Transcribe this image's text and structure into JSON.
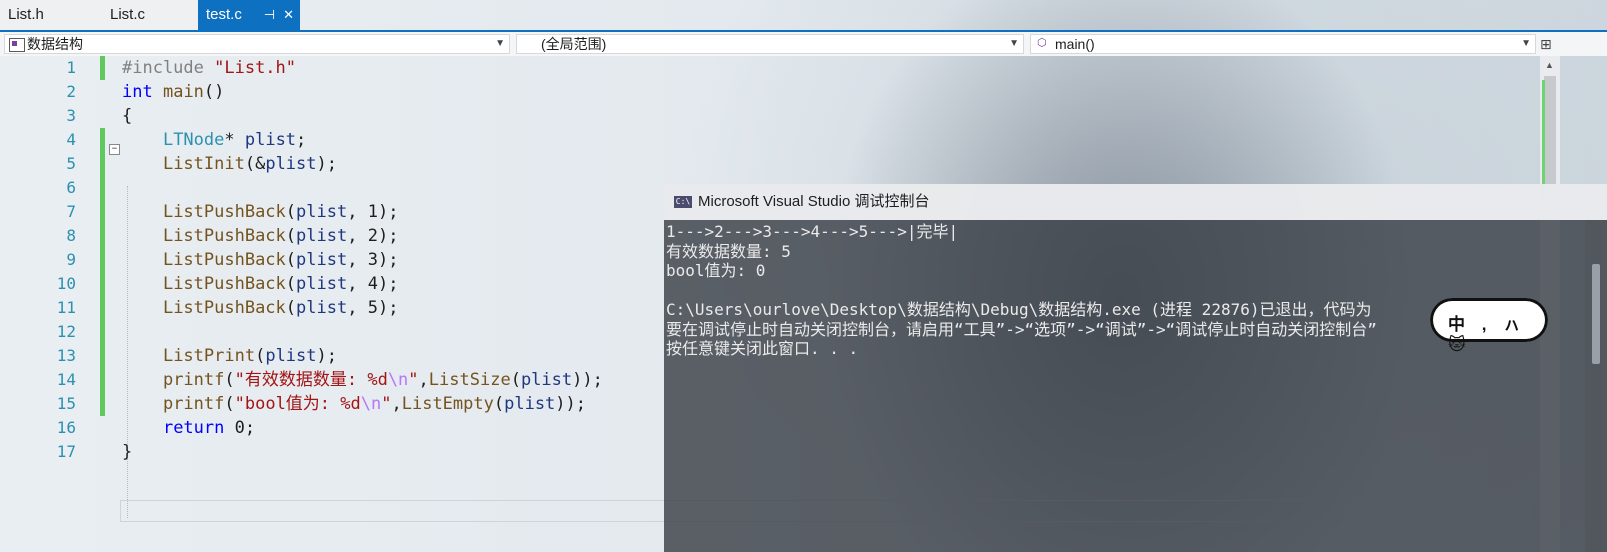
{
  "tabs": [
    {
      "label": "List.h"
    },
    {
      "label": "List.c"
    },
    {
      "label": "test.c",
      "active": true,
      "pin_icon": "pin-icon",
      "close_icon": "close-icon"
    }
  ],
  "navbar": {
    "project": "数据结构",
    "scope": "(全局范围)",
    "member": "main()",
    "icons": [
      "project-icon",
      "member-cube-icon",
      "split-editor-icon"
    ]
  },
  "editor": {
    "line_numbers": [
      "1",
      "2",
      "3",
      "4",
      "5",
      "6",
      "7",
      "8",
      "9",
      "10",
      "11",
      "12",
      "13",
      "14",
      "15",
      "16",
      "17"
    ],
    "lines": [
      [
        {
          "t": "#include ",
          "c": "pp"
        },
        {
          "t": "\"List.h\"",
          "c": "str"
        }
      ],
      [
        {
          "t": "int",
          "c": "kw"
        },
        {
          "t": " ",
          "c": "pl"
        },
        {
          "t": "main",
          "c": "fn"
        },
        {
          "t": "()",
          "c": "pl"
        }
      ],
      [
        {
          "t": "{",
          "c": "pl"
        }
      ],
      [
        {
          "t": "    ",
          "c": "pl"
        },
        {
          "t": "LTNode",
          "c": "ty"
        },
        {
          "t": "* ",
          "c": "pl"
        },
        {
          "t": "plist",
          "c": "var"
        },
        {
          "t": ";",
          "c": "pl"
        }
      ],
      [
        {
          "t": "    ",
          "c": "pl"
        },
        {
          "t": "ListInit",
          "c": "fn"
        },
        {
          "t": "(&",
          "c": "pl"
        },
        {
          "t": "plist",
          "c": "var"
        },
        {
          "t": ");",
          "c": "pl"
        }
      ],
      [
        {
          "t": "",
          "c": "pl"
        }
      ],
      [
        {
          "t": "    ",
          "c": "pl"
        },
        {
          "t": "ListPushBack",
          "c": "fn"
        },
        {
          "t": "(",
          "c": "pl"
        },
        {
          "t": "plist",
          "c": "var"
        },
        {
          "t": ", ",
          "c": "pl"
        },
        {
          "t": "1",
          "c": "pl"
        },
        {
          "t": ");",
          "c": "pl"
        }
      ],
      [
        {
          "t": "    ",
          "c": "pl"
        },
        {
          "t": "ListPushBack",
          "c": "fn"
        },
        {
          "t": "(",
          "c": "pl"
        },
        {
          "t": "plist",
          "c": "var"
        },
        {
          "t": ", ",
          "c": "pl"
        },
        {
          "t": "2",
          "c": "pl"
        },
        {
          "t": ");",
          "c": "pl"
        }
      ],
      [
        {
          "t": "    ",
          "c": "pl"
        },
        {
          "t": "ListPushBack",
          "c": "fn"
        },
        {
          "t": "(",
          "c": "pl"
        },
        {
          "t": "plist",
          "c": "var"
        },
        {
          "t": ", ",
          "c": "pl"
        },
        {
          "t": "3",
          "c": "pl"
        },
        {
          "t": ");",
          "c": "pl"
        }
      ],
      [
        {
          "t": "    ",
          "c": "pl"
        },
        {
          "t": "ListPushBack",
          "c": "fn"
        },
        {
          "t": "(",
          "c": "pl"
        },
        {
          "t": "plist",
          "c": "var"
        },
        {
          "t": ", ",
          "c": "pl"
        },
        {
          "t": "4",
          "c": "pl"
        },
        {
          "t": ");",
          "c": "pl"
        }
      ],
      [
        {
          "t": "    ",
          "c": "pl"
        },
        {
          "t": "ListPushBack",
          "c": "fn"
        },
        {
          "t": "(",
          "c": "pl"
        },
        {
          "t": "plist",
          "c": "var"
        },
        {
          "t": ", ",
          "c": "pl"
        },
        {
          "t": "5",
          "c": "pl"
        },
        {
          "t": ");",
          "c": "pl"
        }
      ],
      [
        {
          "t": "",
          "c": "pl"
        }
      ],
      [
        {
          "t": "    ",
          "c": "pl"
        },
        {
          "t": "ListPrint",
          "c": "fn"
        },
        {
          "t": "(",
          "c": "pl"
        },
        {
          "t": "plist",
          "c": "var"
        },
        {
          "t": ");",
          "c": "pl"
        }
      ],
      [
        {
          "t": "    ",
          "c": "pl"
        },
        {
          "t": "printf",
          "c": "fn"
        },
        {
          "t": "(",
          "c": "pl"
        },
        {
          "t": "\"有效数据数量: %d",
          "c": "str"
        },
        {
          "t": "\\n",
          "c": "esc"
        },
        {
          "t": "\"",
          "c": "str"
        },
        {
          "t": ",",
          "c": "pl"
        },
        {
          "t": "ListSize",
          "c": "fn"
        },
        {
          "t": "(",
          "c": "pl"
        },
        {
          "t": "plist",
          "c": "var"
        },
        {
          "t": "));",
          "c": "pl"
        }
      ],
      [
        {
          "t": "    ",
          "c": "pl"
        },
        {
          "t": "printf",
          "c": "fn"
        },
        {
          "t": "(",
          "c": "pl"
        },
        {
          "t": "\"bool值为: %d",
          "c": "str"
        },
        {
          "t": "\\n",
          "c": "esc"
        },
        {
          "t": "\"",
          "c": "str"
        },
        {
          "t": ",",
          "c": "pl"
        },
        {
          "t": "ListEmpty",
          "c": "fn"
        },
        {
          "t": "(",
          "c": "pl"
        },
        {
          "t": "plist",
          "c": "var"
        },
        {
          "t": "));",
          "c": "pl"
        }
      ],
      [
        {
          "t": "    ",
          "c": "pl"
        },
        {
          "t": "return",
          "c": "kw"
        },
        {
          "t": " ",
          "c": "pl"
        },
        {
          "t": "0",
          "c": "pl"
        },
        {
          "t": ";",
          "c": "pl"
        }
      ],
      [
        {
          "t": "}",
          "c": "pl"
        }
      ]
    ],
    "modified_lines": [
      1,
      4,
      5,
      6,
      7,
      8,
      9,
      10,
      11,
      12,
      13,
      14,
      15
    ],
    "fold_marker": "−"
  },
  "console": {
    "title": "Microsoft Visual Studio 调试控制台",
    "icon_label": "C:\\",
    "lines": [
      "1--->2--->3--->4--->5--->|完毕|",
      "有效数据数量: 5",
      "bool值为: 0",
      "",
      "C:\\Users\\ourlove\\Desktop\\数据结构\\Debug\\数据结构.exe (进程 22876)已退出，代码为",
      "要在调试停止时自动关闭控制台，请启用“工具”->“选项”->“调试”->“调试停止时自动关闭控制台”",
      "按任意键关闭此窗口. . ."
    ]
  },
  "badge": {
    "text": "中 ,  ㇵ 🐱"
  },
  "colors": {
    "accent": "#0e70c0",
    "line_number": "#2b91af",
    "keyword": "#0000ff",
    "string": "#a31515",
    "function": "#74531f",
    "type": "#2b91af",
    "variable": "#1f377f",
    "modified_bar": "#5fc95f"
  }
}
